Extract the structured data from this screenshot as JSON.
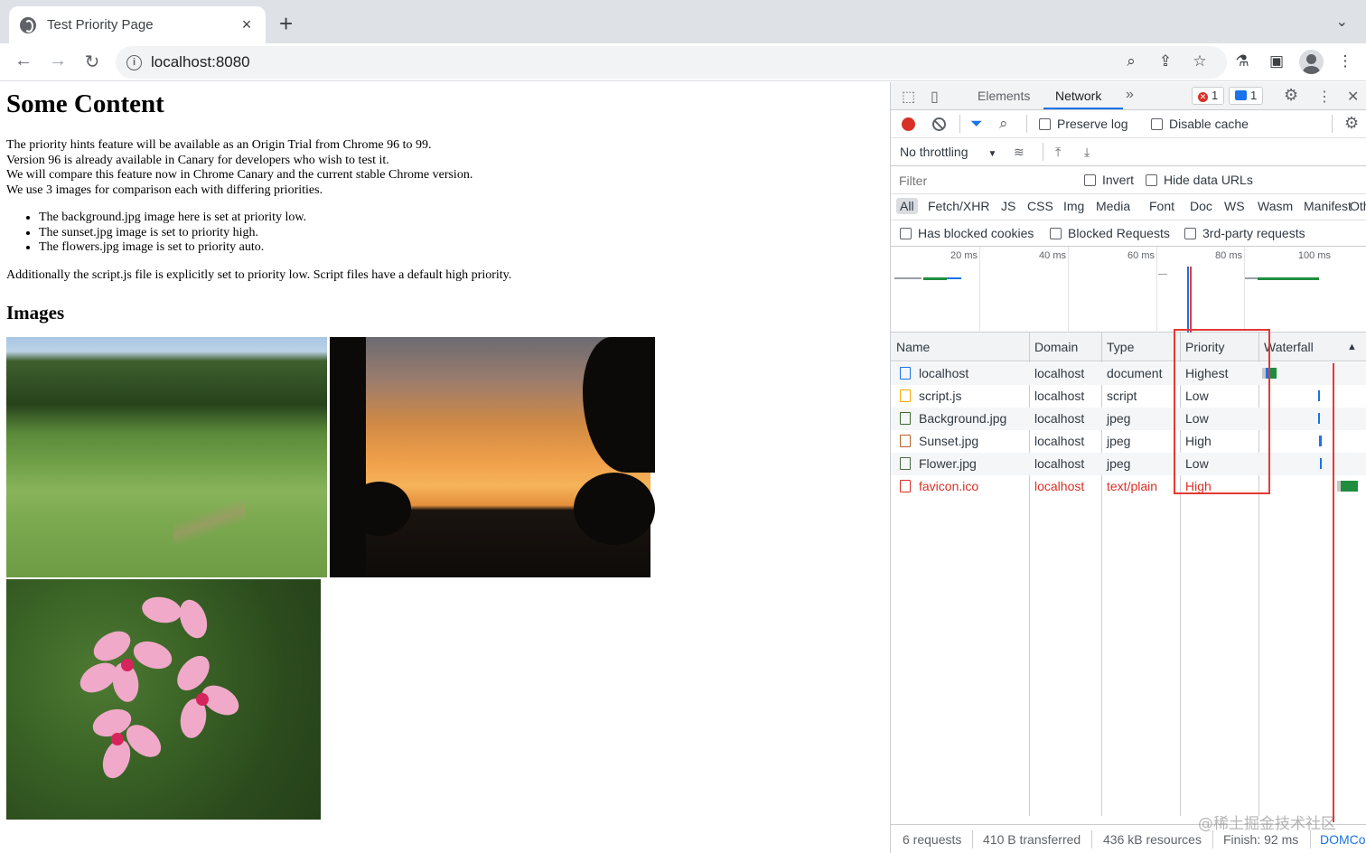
{
  "browser": {
    "tab_title": "Test Priority Page",
    "tab_close": "×",
    "new_tab": "+",
    "tab_menu": "⌄",
    "url": "localhost:8080",
    "info_glyph": "i"
  },
  "page": {
    "heading": "Some Content",
    "intro_lines": [
      "The priority hints feature will be available as an Origin Trial from Chrome 96 to 99.",
      "Version 96 is already available in Canary for developers who wish to test it.",
      "We will compare this feature now in Chrome Canary and the current stable Chrome version.",
      "We use 3 images for comparison each with differing priorities."
    ],
    "bullets": [
      "The background.jpg image here is set at priority low.",
      "The sunset.jpg image is set to priority high.",
      "The flowers.jpg image is set to priority auto."
    ],
    "additional": "Additionally the script.js file is explicitly set to priority low. Script files have a default high priority.",
    "images_heading": "Images"
  },
  "devtools": {
    "tabs": [
      "Elements",
      "Network"
    ],
    "more_tabs": "»",
    "error_count": "1",
    "message_count": "1",
    "preserve_log": "Preserve log",
    "disable_cache": "Disable cache",
    "throttling": "No throttling",
    "filter_placeholder": "Filter",
    "invert": "Invert",
    "hide_data_urls": "Hide data URLs",
    "type_filters": [
      "All",
      "Fetch/XHR",
      "JS",
      "CSS",
      "Img",
      "Media",
      "Font",
      "Doc",
      "WS",
      "Wasm",
      "Manifest",
      "Oth"
    ],
    "has_blocked_cookies": "Has blocked cookies",
    "blocked_requests": "Blocked Requests",
    "third_party": "3rd-party requests",
    "timeline_labels": [
      "20 ms",
      "40 ms",
      "60 ms",
      "80 ms",
      "100 ms"
    ],
    "columns": [
      "Name",
      "Domain",
      "Type",
      "Priority",
      "Waterfall"
    ],
    "sort_arrow": "▲",
    "requests": [
      {
        "name": "localhost",
        "domain": "localhost",
        "type": "document",
        "priority": "Highest",
        "icon_color": "#1a73e8",
        "error": false
      },
      {
        "name": "script.js",
        "domain": "localhost",
        "type": "script",
        "priority": "Low",
        "icon_color": "#f9ab00",
        "error": false
      },
      {
        "name": "Background.jpg",
        "domain": "localhost",
        "type": "jpeg",
        "priority": "Low",
        "icon_color": "#3c6b2f",
        "error": false
      },
      {
        "name": "Sunset.jpg",
        "domain": "localhost",
        "type": "jpeg",
        "priority": "High",
        "icon_color": "#b8602a",
        "error": false
      },
      {
        "name": "Flower.jpg",
        "domain": "localhost",
        "type": "jpeg",
        "priority": "Low",
        "icon_color": "#4a6b44",
        "error": false
      },
      {
        "name": "favicon.ico",
        "domain": "localhost",
        "type": "text/plain",
        "priority": "High",
        "icon_color": "#d93025",
        "error": true
      }
    ],
    "status": {
      "requests": "6 requests",
      "transferred": "410 B transferred",
      "resources": "436 kB resources",
      "finish": "Finish: 92 ms",
      "dom": "DOMCo"
    }
  },
  "watermark": "@稀土掘金技术社区",
  "colors": {
    "accent": "#1a73e8",
    "error": "#d93025",
    "highlight": "#e53935"
  }
}
